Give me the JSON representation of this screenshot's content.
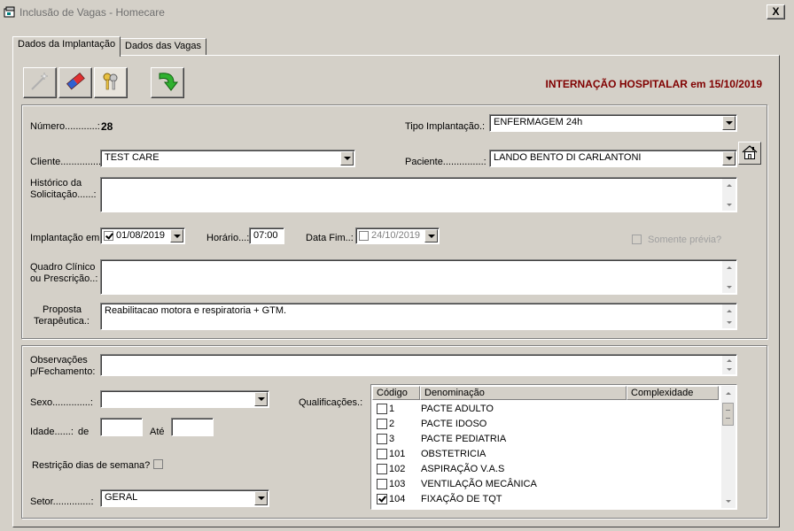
{
  "window": {
    "title": "Inclusão de Vagas - Homecare",
    "close_label": "X"
  },
  "tabs": [
    {
      "label": "Dados da Implantação"
    },
    {
      "label": "Dados das Vagas"
    }
  ],
  "toolbar": {
    "buttons": [
      "new-icon",
      "eraser-icon",
      "keys-icon",
      "green-arrow-icon"
    ]
  },
  "headline": "INTERNAÇÃO HOSPITALAR em 15/10/2019",
  "implantacao": {
    "numero_label": "Número............:",
    "numero_value": "28",
    "tipo_label": "Tipo Implantação.:",
    "tipo_value": "ENFERMAGEM 24h",
    "cliente_label": "Cliente...............:",
    "cliente_value": "TEST CARE",
    "paciente_label": "Paciente...............:",
    "paciente_value": "LANDO BENTO DI CARLANTONI",
    "historico_label_1": "Histórico da",
    "historico_label_2": "Solicitação......:",
    "historico_value": "",
    "implantacao_em_label": "Implantação em:",
    "implantacao_em_value": "01/08/2019",
    "horario_label": "Horário...:",
    "horario_value": "07:00",
    "data_fim_label": "Data Fim..:",
    "data_fim_value": "24/10/2019",
    "somente_previa_label": "Somente prévia?",
    "quadro_label_1": "Quadro Clínico",
    "quadro_label_2": "ou Prescrição..:",
    "quadro_value": "",
    "proposta_label_1": "Proposta",
    "proposta_label_2": "Terapêutica.:",
    "proposta_value": "Reabilitacao motora e respiratoria + GTM."
  },
  "vagas": {
    "observacoes_label_1": "Observações",
    "observacoes_label_2": "p/Fechamento:",
    "observacoes_value": "",
    "sexo_label": "Sexo..............:",
    "sexo_value": "",
    "idade_label": "Idade......:",
    "de_label": "de",
    "ate_label": "Até",
    "idade_de_value": "",
    "idade_ate_value": "",
    "restricao_label": "Restrição dias de semana?",
    "setor_label": "Setor..............:",
    "setor_value": "GERAL",
    "qualificacoes_label": "Qualificações.:",
    "grid_headers": [
      "Código",
      "Denominação",
      "Complexidade"
    ],
    "qualificacoes": [
      {
        "codigo": "1",
        "nome": "PACTE ADULTO",
        "checked": false
      },
      {
        "codigo": "2",
        "nome": "PACTE IDOSO",
        "checked": false
      },
      {
        "codigo": "3",
        "nome": "PACTE PEDIATRIA",
        "checked": false
      },
      {
        "codigo": "101",
        "nome": "OBSTETRICIA",
        "checked": false
      },
      {
        "codigo": "102",
        "nome": "ASPIRAÇÃO V.A.S",
        "checked": false
      },
      {
        "codigo": "103",
        "nome": "VENTILAÇÃO MECÂNICA",
        "checked": false
      },
      {
        "codigo": "104",
        "nome": "FIXAÇÃO DE TQT",
        "checked": true
      }
    ]
  },
  "colors": {
    "headline": "#800000",
    "window_bg": "#d4d0c8",
    "field_bg": "#ffffff"
  }
}
